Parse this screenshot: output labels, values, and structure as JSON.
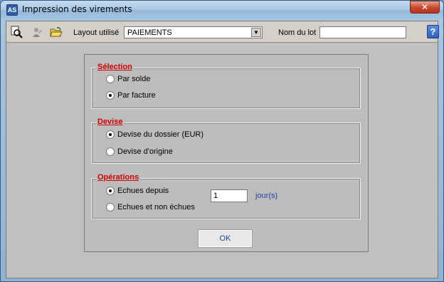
{
  "window": {
    "title": "Impression des virements",
    "app_icon_text": "AS",
    "close_glyph": "✕"
  },
  "toolbar": {
    "preview_icon": "magnifier-icon",
    "person_icon": "person-icon",
    "open_icon": "folder-open-icon",
    "layout_label": "Layout utilisé",
    "layout_value": "PAIEMENTS",
    "lot_label": "Nom du lot",
    "lot_value": "",
    "help_glyph": "?"
  },
  "form": {
    "selection": {
      "legend": "Sélection",
      "options": [
        {
          "label": "Par solde",
          "checked": false
        },
        {
          "label": "Par facture",
          "checked": true
        }
      ]
    },
    "devise": {
      "legend": "Devise",
      "options": [
        {
          "label": "Devise du dossier (EUR)",
          "checked": true
        },
        {
          "label": "Devise d'origine",
          "checked": false
        }
      ]
    },
    "operations": {
      "legend": "Opérations",
      "options": [
        {
          "label": "Echues depuis",
          "checked": true
        },
        {
          "label": "Echues et non échues",
          "checked": false
        }
      ],
      "days_value": "1",
      "days_unit": "jour(s)"
    },
    "ok_label": "OK"
  }
}
